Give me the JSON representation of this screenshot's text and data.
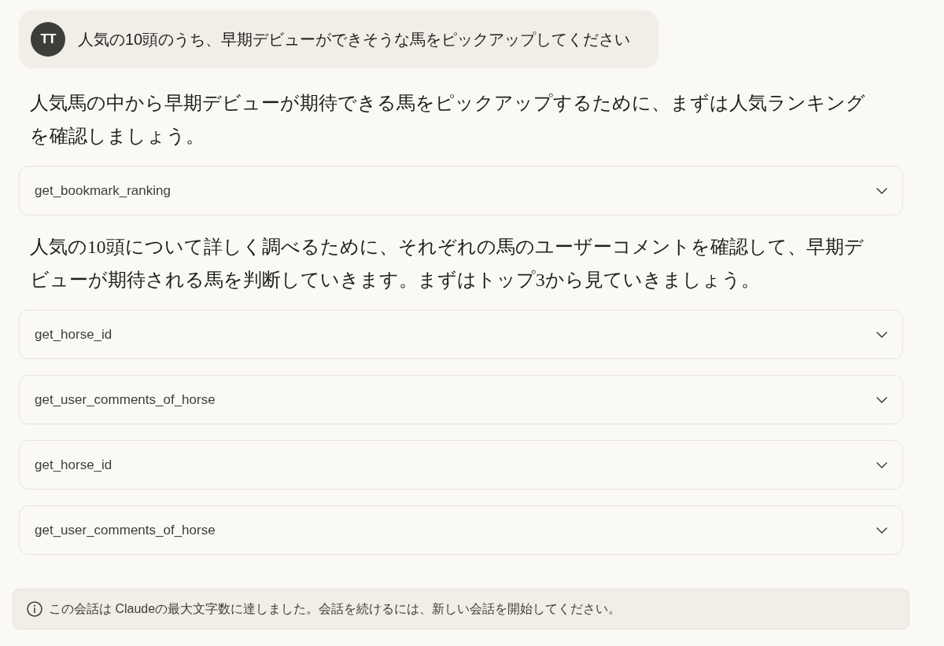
{
  "user_message": {
    "avatar_initials": "TT",
    "text": "人気の10頭のうち、早期デビューができそうな馬をピックアップしてください"
  },
  "assistant_turns": [
    {
      "kind": "text",
      "text": "人気馬の中から早期デビューが期待できる馬をピックアップするために、まずは人気ランキングを確認しましょう。"
    },
    {
      "kind": "tool_call",
      "name": "get_bookmark_ranking",
      "expanded": false
    },
    {
      "kind": "text",
      "text": "人気の10頭について詳しく調べるために、それぞれの馬のユーザーコメントを確認して、早期デビューが期待される馬を判断していきます。まずはトップ3から見ていきましょう。"
    },
    {
      "kind": "tool_call",
      "name": "get_horse_id",
      "expanded": false
    },
    {
      "kind": "tool_call",
      "name": "get_user_comments_of_horse",
      "expanded": false
    },
    {
      "kind": "tool_call",
      "name": "get_horse_id",
      "expanded": false
    },
    {
      "kind": "tool_call",
      "name": "get_user_comments_of_horse",
      "expanded": false
    }
  ],
  "notice": {
    "text": "この会話は Claudeの最大文字数に達しました。会話を続けるには、新しい会話を開始してください。"
  }
}
